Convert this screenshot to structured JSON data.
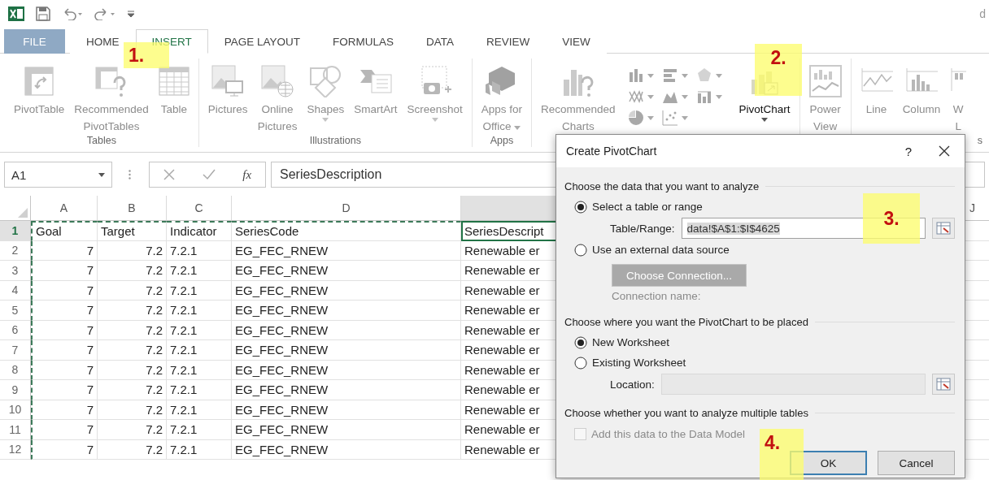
{
  "window": {
    "title_fragment": "d"
  },
  "tabs": [
    {
      "label": "FILE",
      "kind": "file",
      "selected": false
    },
    {
      "label": "HOME",
      "kind": "tab",
      "selected": false
    },
    {
      "label": "INSERT",
      "kind": "tab",
      "selected": true
    },
    {
      "label": "PAGE LAYOUT",
      "kind": "tab",
      "selected": false
    },
    {
      "label": "FORMULAS",
      "kind": "tab",
      "selected": false
    },
    {
      "label": "DATA",
      "kind": "tab",
      "selected": false
    },
    {
      "label": "REVIEW",
      "kind": "tab",
      "selected": false
    },
    {
      "label": "VIEW",
      "kind": "tab",
      "selected": false
    }
  ],
  "ribbon_groups": [
    {
      "label": "Tables",
      "items": [
        {
          "kind": "pivot-table",
          "lines": [
            "PivotTable"
          ],
          "dropdown": false,
          "disabled": true
        },
        {
          "kind": "recommended-pivot-tables",
          "lines": [
            "Recommended",
            "PivotTables"
          ],
          "dropdown": false,
          "disabled": true
        },
        {
          "kind": "table",
          "lines": [
            "Table"
          ],
          "dropdown": false,
          "disabled": true
        }
      ]
    },
    {
      "label": "Illustrations",
      "items": [
        {
          "kind": "pictures",
          "lines": [
            "Pictures"
          ],
          "dropdown": false,
          "disabled": true
        },
        {
          "kind": "online-pictures",
          "lines": [
            "Online",
            "Pictures"
          ],
          "dropdown": false,
          "disabled": true
        },
        {
          "kind": "shapes",
          "lines": [
            "Shapes"
          ],
          "dropdown": true,
          "disabled": true
        },
        {
          "kind": "smartart",
          "lines": [
            "SmartArt"
          ],
          "dropdown": false,
          "disabled": true
        },
        {
          "kind": "screenshot",
          "lines": [
            "Screenshot"
          ],
          "dropdown": true,
          "disabled": true
        }
      ]
    },
    {
      "label": "Apps",
      "items": [
        {
          "kind": "apps-for-office",
          "lines": [
            "Apps for",
            "Office"
          ],
          "dropdown": true,
          "disabled": true
        }
      ]
    },
    {
      "items": [
        {
          "kind": "recommended-charts",
          "lines": [
            "Recommended",
            "Charts"
          ],
          "dropdown": false,
          "disabled": true
        },
        {
          "kind": "chart-gallery"
        },
        {
          "kind": "pivot-chart",
          "lines": [
            "PivotChart"
          ],
          "dropdown": true,
          "disabled": false
        }
      ]
    },
    {
      "items": [
        {
          "kind": "power-view",
          "lines": [
            "Power",
            "View"
          ],
          "dropdown": false,
          "disabled": true
        }
      ]
    },
    {
      "label": "s",
      "items": [
        {
          "kind": "line-sparkline",
          "lines": [
            "Line"
          ],
          "dropdown": false,
          "disabled": true
        },
        {
          "kind": "column-sparkline",
          "lines": [
            "Column"
          ],
          "dropdown": false,
          "disabled": true
        },
        {
          "kind": "win-loss-sparkline",
          "lines": [
            "W",
            "L"
          ],
          "dropdown": false,
          "disabled": true
        }
      ]
    }
  ],
  "formula_bar": {
    "name_box": "A1",
    "function_label": "fx",
    "formula": "SeriesDescription"
  },
  "sheet": {
    "columns": [
      "A",
      "B",
      "C",
      "D"
    ],
    "right_columns": [
      "J"
    ],
    "rows": [
      {
        "number": "1",
        "selected": true,
        "cells": [
          "Goal",
          "Target",
          "Indicator",
          "SeriesCode",
          "SeriesDescript"
        ]
      },
      {
        "number": "2",
        "selected": false,
        "cells": [
          "7",
          "7.2",
          "7.2.1",
          "EG_FEC_RNEW",
          "Renewable er"
        ]
      },
      {
        "number": "3",
        "selected": false,
        "cells": [
          "7",
          "7.2",
          "7.2.1",
          "EG_FEC_RNEW",
          "Renewable er"
        ]
      },
      {
        "number": "4",
        "selected": false,
        "cells": [
          "7",
          "7.2",
          "7.2.1",
          "EG_FEC_RNEW",
          "Renewable er"
        ]
      },
      {
        "number": "5",
        "selected": false,
        "cells": [
          "7",
          "7.2",
          "7.2.1",
          "EG_FEC_RNEW",
          "Renewable er"
        ]
      },
      {
        "number": "6",
        "selected": false,
        "cells": [
          "7",
          "7.2",
          "7.2.1",
          "EG_FEC_RNEW",
          "Renewable er"
        ]
      },
      {
        "number": "7",
        "selected": false,
        "cells": [
          "7",
          "7.2",
          "7.2.1",
          "EG_FEC_RNEW",
          "Renewable er"
        ]
      },
      {
        "number": "8",
        "selected": false,
        "cells": [
          "7",
          "7.2",
          "7.2.1",
          "EG_FEC_RNEW",
          "Renewable er"
        ]
      },
      {
        "number": "9",
        "selected": false,
        "cells": [
          "7",
          "7.2",
          "7.2.1",
          "EG_FEC_RNEW",
          "Renewable er"
        ]
      },
      {
        "number": "10",
        "selected": false,
        "cells": [
          "7",
          "7.2",
          "7.2.1",
          "EG_FEC_RNEW",
          "Renewable er"
        ]
      },
      {
        "number": "11",
        "selected": false,
        "cells": [
          "7",
          "7.2",
          "7.2.1",
          "EG_FEC_RNEW",
          "Renewable er"
        ]
      },
      {
        "number": "12",
        "selected": false,
        "cells": [
          "7",
          "7.2",
          "7.2.1",
          "EG_FEC_RNEW",
          "Renewable er"
        ]
      }
    ]
  },
  "dialog": {
    "title": "Create PivotChart",
    "help": "?",
    "source_heading": "Choose the data that you want to analyze",
    "source_options": [
      {
        "label": "Select a table or range",
        "selected": true
      },
      {
        "label": "Use an external data source",
        "selected": false
      }
    ],
    "range_label": "Table/Range:",
    "range_value": "data!$A$1:$I$4625",
    "choose_connection": {
      "label": "Choose Connection...",
      "disabled": true
    },
    "connection_label": "Connection name:",
    "placement_heading": "Choose where you want the PivotChart to be placed",
    "placement_options": [
      {
        "label": "New Worksheet",
        "selected": true
      },
      {
        "label": "Existing Worksheet",
        "selected": false
      }
    ],
    "location_label": "Location:",
    "location_disabled": true,
    "tables_heading": "Choose whether you want to analyze multiple tables",
    "data_model": {
      "label": "Add this data to the Data Model",
      "checked": false,
      "disabled": true
    },
    "buttons": [
      {
        "label": "OK",
        "default": true
      },
      {
        "label": "Cancel",
        "default": false
      }
    ]
  },
  "callouts": [
    {
      "label": "1."
    },
    {
      "label": "2."
    },
    {
      "label": "3."
    },
    {
      "label": "4."
    }
  ]
}
